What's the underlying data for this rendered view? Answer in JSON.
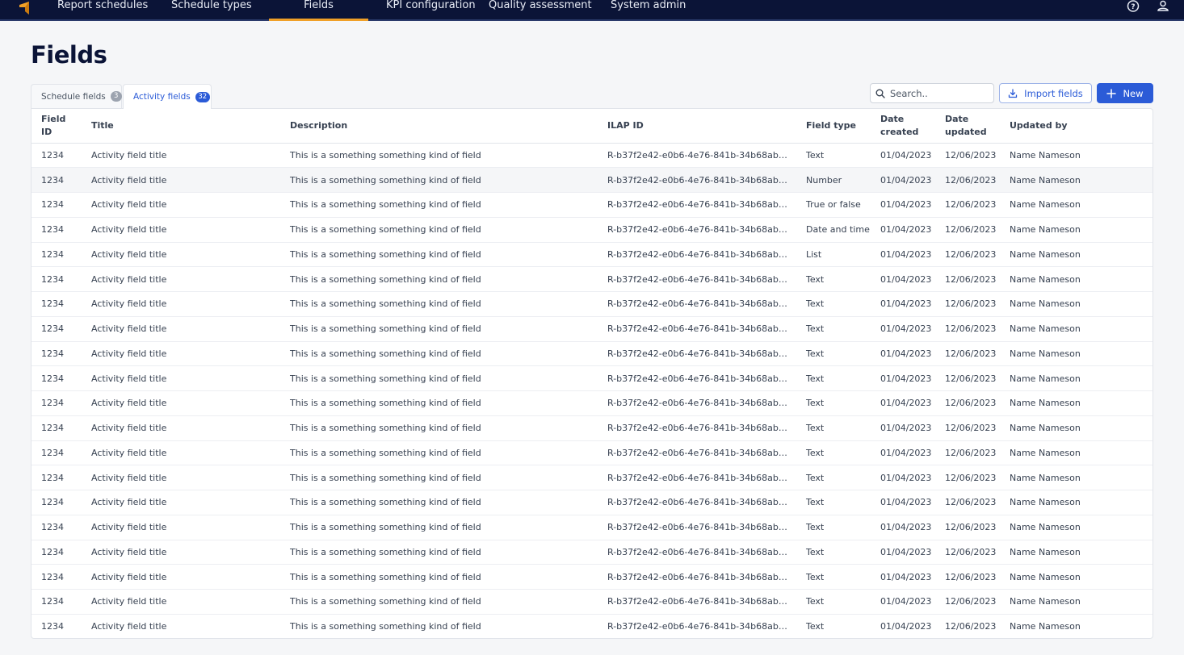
{
  "nav": {
    "items": [
      "Report schedules",
      "Schedule types",
      "Fields",
      "KPI configuration",
      "Quality assessment",
      "System admin"
    ],
    "active_index": 2,
    "accent": "#f0a028",
    "bar_color": "#0b1437"
  },
  "page": {
    "title": "Fields"
  },
  "tabs": [
    {
      "label": "Schedule fields",
      "count": "3"
    },
    {
      "label": "Activity fields",
      "count": "32"
    }
  ],
  "active_tab": 1,
  "toolbar": {
    "search_placeholder": "Search..",
    "import_label": "Import fields",
    "new_label": "New",
    "primary_color": "#2b5bd7"
  },
  "table": {
    "columns": [
      "Field ID",
      "Title",
      "Description",
      "ILAP ID",
      "Field type",
      "Date created",
      "Date updated",
      "Updated by"
    ],
    "rows": [
      [
        "1234",
        "Activity field title",
        "This is a something something kind of field",
        "R-b37f2e42-e0b6-4e76-841b-34b68ab81...",
        "Text",
        "01/04/2023",
        "12/06/2023",
        "Name Nameson"
      ],
      [
        "1234",
        "Activity field title",
        "This is a something something kind of field",
        "R-b37f2e42-e0b6-4e76-841b-34b68ab81...",
        "Number",
        "01/04/2023",
        "12/06/2023",
        "Name Nameson"
      ],
      [
        "1234",
        "Activity field title",
        "This is a something something kind of field",
        "R-b37f2e42-e0b6-4e76-841b-34b68ab81...",
        "True or false",
        "01/04/2023",
        "12/06/2023",
        "Name Nameson"
      ],
      [
        "1234",
        "Activity field title",
        "This is a something something kind of field",
        "R-b37f2e42-e0b6-4e76-841b-34b68ab81...",
        "Date and time",
        "01/04/2023",
        "12/06/2023",
        "Name Nameson"
      ],
      [
        "1234",
        "Activity field title",
        "This is a something something kind of field",
        "R-b37f2e42-e0b6-4e76-841b-34b68ab81...",
        "List",
        "01/04/2023",
        "12/06/2023",
        "Name Nameson"
      ],
      [
        "1234",
        "Activity field title",
        "This is a something something kind of field",
        "R-b37f2e42-e0b6-4e76-841b-34b68ab81...",
        "Text",
        "01/04/2023",
        "12/06/2023",
        "Name Nameson"
      ],
      [
        "1234",
        "Activity field title",
        "This is a something something kind of field",
        "R-b37f2e42-e0b6-4e76-841b-34b68ab81...",
        "Text",
        "01/04/2023",
        "12/06/2023",
        "Name Nameson"
      ],
      [
        "1234",
        "Activity field title",
        "This is a something something kind of field",
        "R-b37f2e42-e0b6-4e76-841b-34b68ab81...",
        "Text",
        "01/04/2023",
        "12/06/2023",
        "Name Nameson"
      ],
      [
        "1234",
        "Activity field title",
        "This is a something something kind of field",
        "R-b37f2e42-e0b6-4e76-841b-34b68ab81...",
        "Text",
        "01/04/2023",
        "12/06/2023",
        "Name Nameson"
      ],
      [
        "1234",
        "Activity field title",
        "This is a something something kind of field",
        "R-b37f2e42-e0b6-4e76-841b-34b68ab81...",
        "Text",
        "01/04/2023",
        "12/06/2023",
        "Name Nameson"
      ],
      [
        "1234",
        "Activity field title",
        "This is a something something kind of field",
        "R-b37f2e42-e0b6-4e76-841b-34b68ab81...",
        "Text",
        "01/04/2023",
        "12/06/2023",
        "Name Nameson"
      ],
      [
        "1234",
        "Activity field title",
        "This is a something something kind of field",
        "R-b37f2e42-e0b6-4e76-841b-34b68ab81...",
        "Text",
        "01/04/2023",
        "12/06/2023",
        "Name Nameson"
      ],
      [
        "1234",
        "Activity field title",
        "This is a something something kind of field",
        "R-b37f2e42-e0b6-4e76-841b-34b68ab81...",
        "Text",
        "01/04/2023",
        "12/06/2023",
        "Name Nameson"
      ],
      [
        "1234",
        "Activity field title",
        "This is a something something kind of field",
        "R-b37f2e42-e0b6-4e76-841b-34b68ab81...",
        "Text",
        "01/04/2023",
        "12/06/2023",
        "Name Nameson"
      ],
      [
        "1234",
        "Activity field title",
        "This is a something something kind of field",
        "R-b37f2e42-e0b6-4e76-841b-34b68ab81...",
        "Text",
        "01/04/2023",
        "12/06/2023",
        "Name Nameson"
      ],
      [
        "1234",
        "Activity field title",
        "This is a something something kind of field",
        "R-b37f2e42-e0b6-4e76-841b-34b68ab81...",
        "Text",
        "01/04/2023",
        "12/06/2023",
        "Name Nameson"
      ],
      [
        "1234",
        "Activity field title",
        "This is a something something kind of field",
        "R-b37f2e42-e0b6-4e76-841b-34b68ab81...",
        "Text",
        "01/04/2023",
        "12/06/2023",
        "Name Nameson"
      ],
      [
        "1234",
        "Activity field title",
        "This is a something something kind of field",
        "R-b37f2e42-e0b6-4e76-841b-34b68ab81...",
        "Text",
        "01/04/2023",
        "12/06/2023",
        "Name Nameson"
      ],
      [
        "1234",
        "Activity field title",
        "This is a something something kind of field",
        "R-b37f2e42-e0b6-4e76-841b-34b68ab81...",
        "Text",
        "01/04/2023",
        "12/06/2023",
        "Name Nameson"
      ],
      [
        "1234",
        "Activity field title",
        "This is a something something kind of field",
        "R-b37f2e42-e0b6-4e76-841b-34b68ab81...",
        "Text",
        "01/04/2023",
        "12/06/2023",
        "Name Nameson"
      ]
    ],
    "highlighted_row": 1
  },
  "icons": {
    "logo": "app-logo-icon",
    "help": "help-icon",
    "user": "user-icon",
    "search": "search-icon",
    "import": "download-icon",
    "new": "plus-icon"
  }
}
